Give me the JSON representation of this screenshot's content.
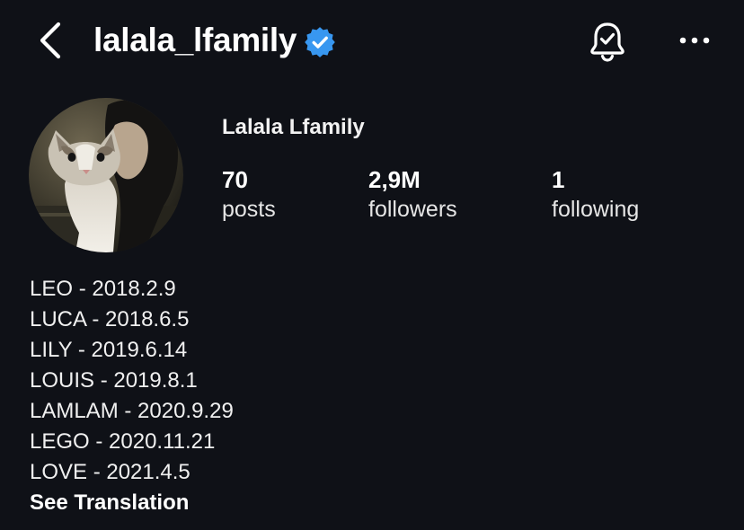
{
  "header": {
    "username": "lalala_lfamily",
    "verified": true,
    "back_icon": "chevron-left-icon",
    "notification_icon": "bell-check-icon",
    "more_icon": "more-horizontal-icon"
  },
  "profile": {
    "display_name": "Lalala Lfamily",
    "avatar_description_icon": "profile-photo"
  },
  "stats": {
    "posts": {
      "value": "70",
      "label": "posts"
    },
    "followers": {
      "value": "2,9M",
      "label": "followers"
    },
    "following": {
      "value": "1",
      "label": "following"
    }
  },
  "bio": {
    "lines": [
      "LEO - 2018.2.9",
      "LUCA - 2018.6.5",
      "LILY - 2019.6.14",
      "LOUIS - 2019.8.1",
      "LAMLAM - 2020.9.29",
      "LEGO - 2020.11.21",
      "LOVE - 2021.4.5"
    ],
    "see_translation": "See Translation"
  },
  "colors": {
    "background": "#0f1117",
    "text": "#ffffff",
    "verified_blue": "#3897f0"
  }
}
